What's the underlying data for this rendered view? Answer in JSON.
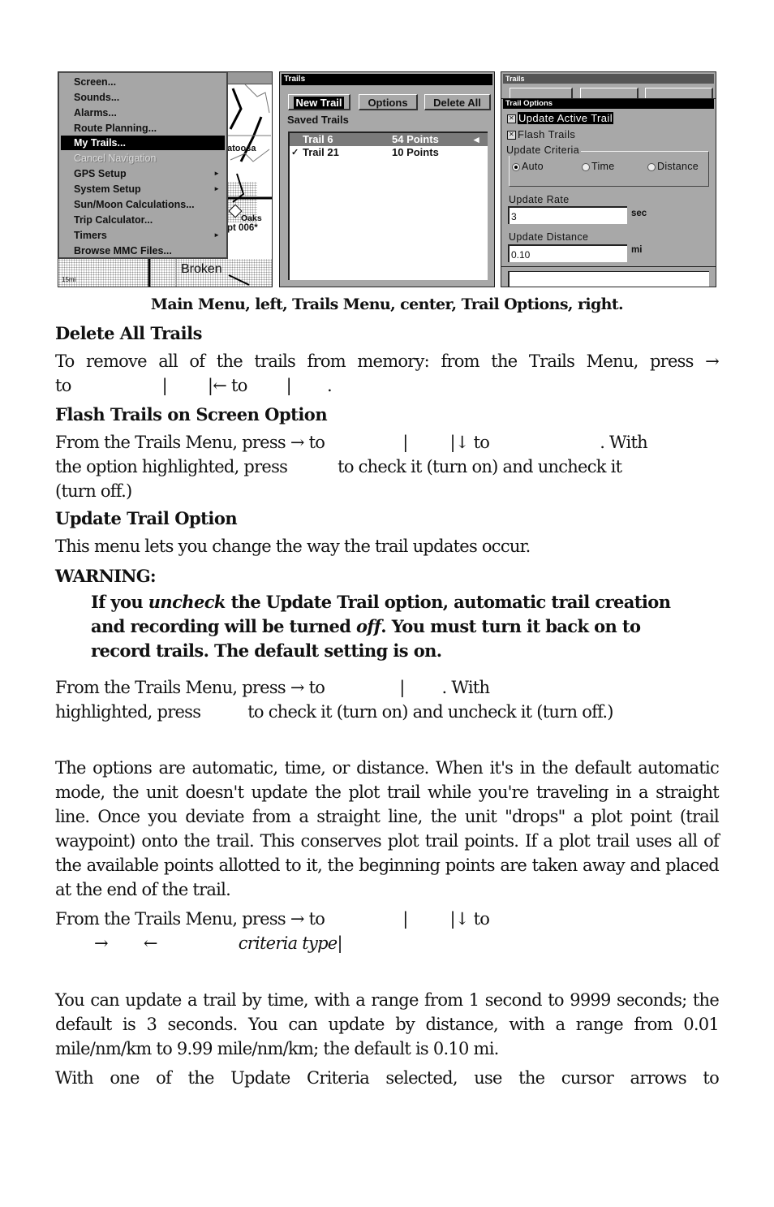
{
  "screens": {
    "main_menu": {
      "items": [
        {
          "label": "Screen...",
          "state": "normal"
        },
        {
          "label": "Sounds...",
          "state": "normal"
        },
        {
          "label": "Alarms...",
          "state": "normal"
        },
        {
          "label": "Route Planning...",
          "state": "normal"
        },
        {
          "label": "My Trails...",
          "state": "selected"
        },
        {
          "label": "Cancel Navigation",
          "state": "disabled"
        },
        {
          "label": "GPS Setup",
          "state": "submenu"
        },
        {
          "label": "System Setup",
          "state": "submenu"
        },
        {
          "label": "Sun/Moon Calculations...",
          "state": "normal"
        },
        {
          "label": "Trip Calculator...",
          "state": "normal"
        },
        {
          "label": "Timers",
          "state": "submenu"
        },
        {
          "label": "Browse MMC Files...",
          "state": "normal"
        }
      ],
      "map_labels": {
        "town1": "atoosa",
        "poi1": "Oaks",
        "poi2": "pt 006*",
        "town2": "Broken",
        "scale": "15mi"
      }
    },
    "trails_menu": {
      "title": "Trails",
      "buttons": {
        "new_trail": "New Trail",
        "options": "Options",
        "delete_all": "Delete All"
      },
      "saved_label": "Saved Trails",
      "trails": [
        {
          "name": "Trail 6",
          "points": "54 Points",
          "checked": false,
          "selected": true
        },
        {
          "name": "Trail 21",
          "points": "10 Points",
          "checked": true,
          "selected": false
        }
      ],
      "check_glyph": "✓",
      "pointer_glyph": "◄"
    },
    "trail_options": {
      "behind_title": "Trails",
      "title": "Trail Options",
      "update_active_trail": {
        "label": "Update Active Trail",
        "checked": true
      },
      "flash_trails": {
        "label": "Flash Trails",
        "checked": true
      },
      "criteria_label": "Update Criteria",
      "criteria_options": [
        "Auto",
        "Time",
        "Distance"
      ],
      "criteria_selected": "Auto",
      "update_rate_label": "Update Rate",
      "update_rate_value": "3",
      "update_rate_unit": "sec",
      "update_distance_label": "Update Distance",
      "update_distance_value": "0.10",
      "update_distance_unit": "mi",
      "check_glyph": "✕"
    }
  },
  "caption": "Main Menu, left, Trails Menu, center, Trail Options, right.",
  "sections": {
    "delete_all": {
      "heading": "Delete All Trails",
      "line1": "To remove all of the trails from memory: from the Trails Menu, press →",
      "line2_parts": [
        "to",
        "|",
        "|← to",
        "|",
        "."
      ]
    },
    "flash": {
      "heading": "Flash Trails on Screen Option",
      "line1_parts": [
        "From the Trails Menu, press → to",
        "|",
        "|↓ to",
        ". With"
      ],
      "line2_parts": [
        "the option highlighted, press",
        "to check it (turn on) and uncheck it"
      ],
      "line3": "(turn off.)"
    },
    "update": {
      "heading": "Update Trail Option",
      "intro": "This menu lets you change the way the trail updates occur.",
      "warning_label": "WARNING:",
      "warning_pre": "If you ",
      "warning_em1": "uncheck",
      "warning_mid": " the Update Trail option, automatic trail creation and recording will be turned ",
      "warning_em2": "off",
      "warning_post": ". You must turn it back on to record trails. The default setting is on.",
      "steps_line1_parts": [
        "From the Trails Menu, press → to",
        "|",
        ". With"
      ],
      "steps_line2_parts": [
        "highlighted, press",
        "to check it (turn on) and uncheck it (turn off.)"
      ]
    },
    "criteria": {
      "paragraph": "The options are automatic, time, or distance. When it's in the default automatic mode, the unit doesn't update the plot trail while you're traveling in a straight line. Once you deviate from a straight line, the unit \"drops\" a plot point (trail waypoint) onto the trail. This conserves plot trail points. If a plot trail uses all of the available points allotted to it, the beginning points are taken away and placed at the end of the trail.",
      "steps_line1_parts": [
        "From the Trails Menu, press → to",
        "|",
        "|↓ to"
      ],
      "steps_line2_parts": [
        "→",
        "←",
        "criteria type",
        "|"
      ],
      "range_paragraph": "You can update a trail by time, with a range from 1 second to 9999 seconds; the default is 3 seconds. You can update by distance, with a range from 0.01 mile/nm/km to 9.99 mile/nm/km; the default is 0.10 mi.",
      "last_line": "With one of the Update Criteria selected, use the cursor arrows to"
    }
  }
}
